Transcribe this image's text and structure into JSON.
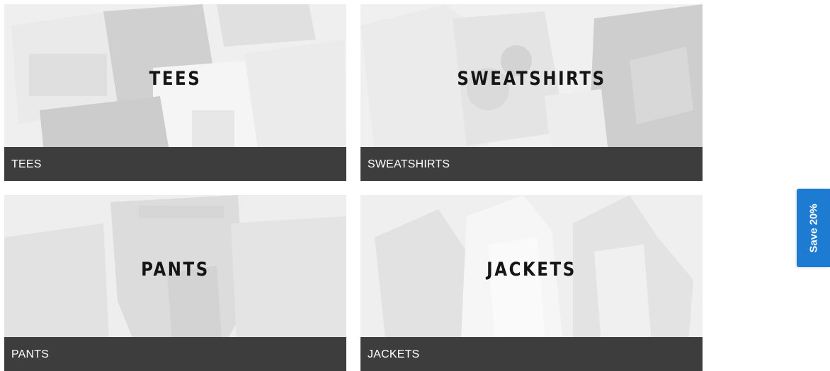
{
  "categories": [
    {
      "title": "TEES",
      "caption": "TEES"
    },
    {
      "title": "SWEATSHIRTS",
      "caption": "SWEATSHIRTS"
    },
    {
      "title": "PANTS",
      "caption": "PANTS"
    },
    {
      "title": "JACKETS",
      "caption": "JACKETS"
    }
  ],
  "promo": {
    "label": "Save 20%",
    "color": "#1d7bd2"
  },
  "colors": {
    "caption_bar": "#3d3d3d",
    "tile_bg": "#e9e9e9"
  }
}
